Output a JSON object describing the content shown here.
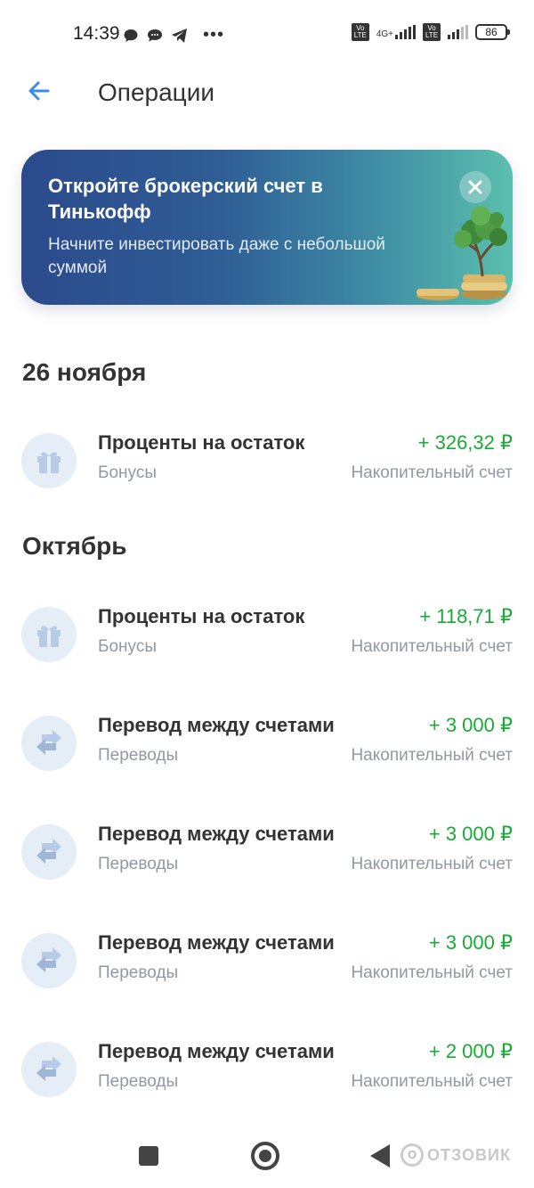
{
  "status_bar": {
    "time": "14:39",
    "network_label": "4G+",
    "battery": "86"
  },
  "header": {
    "title": "Операции"
  },
  "promo": {
    "title": "Откройте брокерский счет в Тинькофф",
    "text": "Начните инвестировать даже с небольшой суммой"
  },
  "sections": [
    {
      "title": "26 ноября",
      "operations": [
        {
          "title": "Проценты на остаток",
          "category": "Бонусы",
          "amount": "+ 326,32 ₽",
          "account": "Накопительный счет",
          "icon": "gift-icon"
        }
      ]
    },
    {
      "title": "Октябрь",
      "operations": [
        {
          "title": "Проценты на остаток",
          "category": "Бонусы",
          "amount": "+ 118,71 ₽",
          "account": "Накопительный счет",
          "icon": "gift-icon"
        },
        {
          "title": "Перевод между счетами",
          "category": "Переводы",
          "amount": "+ 3 000 ₽",
          "account": "Накопительный счет",
          "icon": "transfer-arrows-icon"
        },
        {
          "title": "Перевод между счетами",
          "category": "Переводы",
          "amount": "+ 3 000 ₽",
          "account": "Накопительный счет",
          "icon": "transfer-arrows-icon"
        },
        {
          "title": "Перевод между счетами",
          "category": "Переводы",
          "amount": "+ 3 000 ₽",
          "account": "Накопительный счет",
          "icon": "transfer-arrows-icon"
        },
        {
          "title": "Перевод между счетами",
          "category": "Переводы",
          "amount": "+ 2 000 ₽",
          "account": "Накопительный счет",
          "icon": "transfer-arrows-icon"
        }
      ]
    }
  ],
  "watermark": {
    "text": "ОТЗОВИК",
    "mark": "O"
  },
  "colors": {
    "accent": "#3c8bea",
    "amount_positive": "#1aaa37",
    "secondary_text": "#9299a2",
    "icon_background": "#e5edf7"
  }
}
